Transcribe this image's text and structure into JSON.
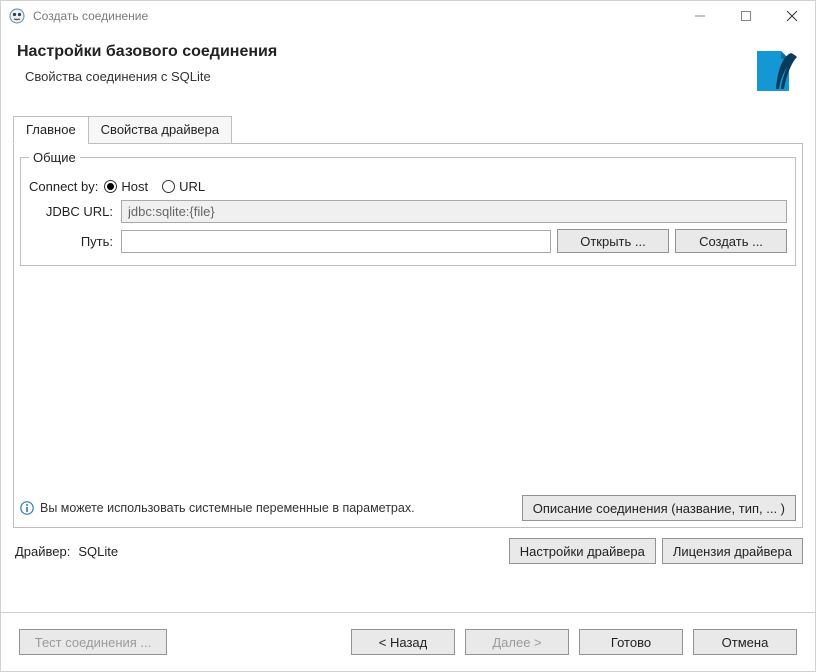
{
  "window": {
    "title": "Создать соединение"
  },
  "header": {
    "title": "Настройки базового соединения",
    "subtitle": "Свойства соединения с SQLite"
  },
  "tabs": {
    "main": "Главное",
    "driver_props": "Свойства драйвера"
  },
  "general": {
    "legend": "Общие",
    "connect_by_label": "Connect by:",
    "host_option": "Host",
    "url_option": "URL",
    "jdbc_label": "JDBC URL:",
    "jdbc_value": "jdbc:sqlite:{file}",
    "path_label": "Путь:",
    "path_value": "",
    "open_btn": "Открыть ...",
    "create_btn": "Создать ..."
  },
  "hint": {
    "text": "Вы можете использовать системные переменные в параметрах.",
    "desc_btn": "Описание соединения (название, тип, ... )"
  },
  "driver": {
    "label": "Драйвер:",
    "value": "SQLite",
    "settings_btn": "Настройки драйвера",
    "license_btn": "Лицензия драйвера"
  },
  "footer": {
    "test": "Тест соединения ...",
    "back": "< Назад",
    "next": "Далее >",
    "finish": "Готово",
    "cancel": "Отмена"
  }
}
